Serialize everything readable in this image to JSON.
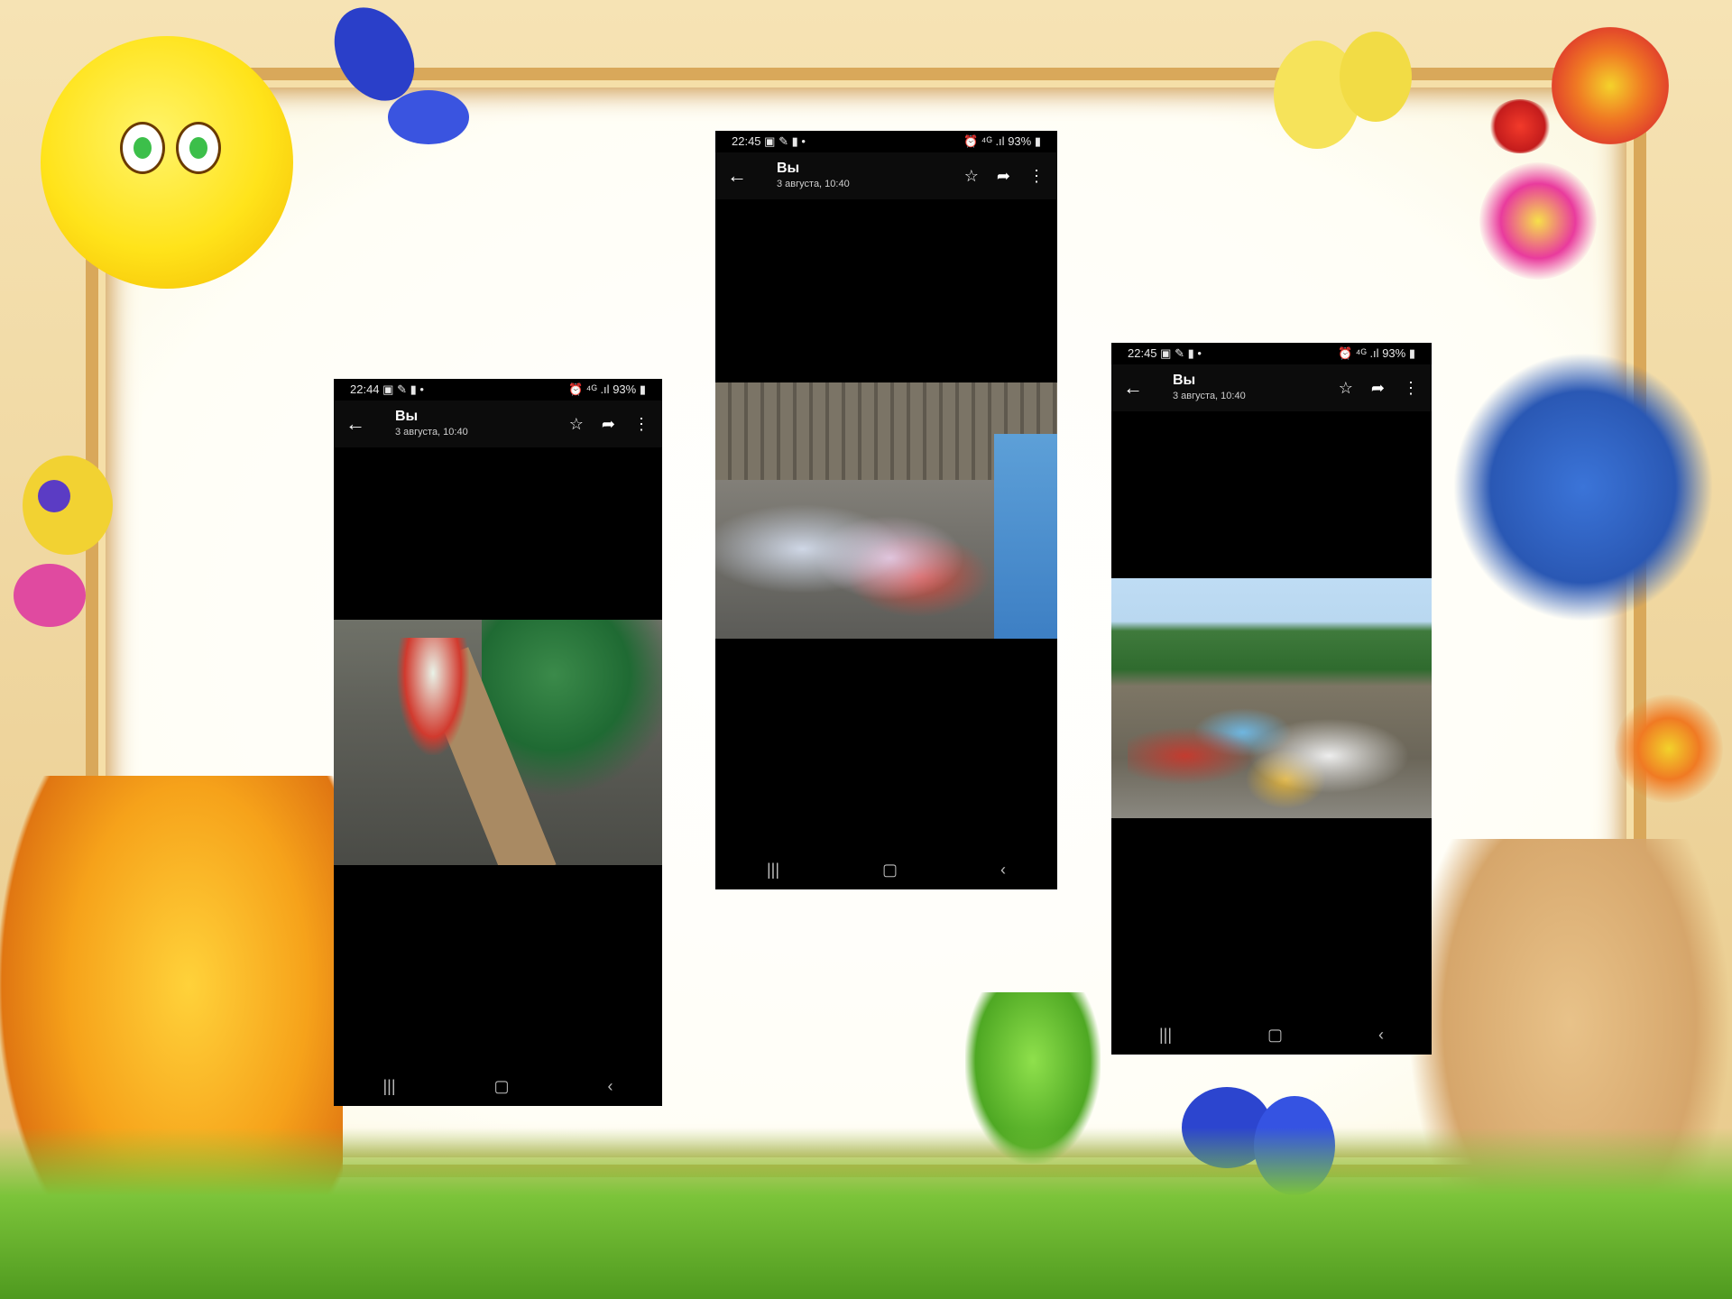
{
  "phones": [
    {
      "status": {
        "time": "22:44",
        "left_icons": "▣ ✎ ▮ •",
        "right_icons": "⏰ ⁴ᴳ .ıl",
        "battery": "93%"
      },
      "appbar": {
        "title": "Вы",
        "subtitle": "3 августа, 10:40"
      },
      "icons": {
        "back": "←",
        "star": "☆",
        "share": "➦",
        "more": "⋮"
      },
      "nav": {
        "recents": "|||",
        "home": "▢",
        "back": "‹"
      }
    },
    {
      "status": {
        "time": "22:45",
        "left_icons": "▣ ✎ ▮ •",
        "right_icons": "⏰ ⁴ᴳ .ıl",
        "battery": "93%"
      },
      "appbar": {
        "title": "Вы",
        "subtitle": "3 августа, 10:40"
      },
      "icons": {
        "back": "←",
        "star": "☆",
        "share": "➦",
        "more": "⋮"
      },
      "nav": {
        "recents": "|||",
        "home": "▢",
        "back": "‹"
      }
    },
    {
      "status": {
        "time": "22:45",
        "left_icons": "▣ ✎ ▮ •",
        "right_icons": "⏰ ⁴ᴳ .ıl",
        "battery": "93%"
      },
      "appbar": {
        "title": "Вы",
        "subtitle": "3 августа, 10:40"
      },
      "icons": {
        "back": "←",
        "star": "☆",
        "share": "➦",
        "more": "⋮"
      },
      "nav": {
        "recents": "|||",
        "home": "▢",
        "back": "‹"
      }
    }
  ],
  "colors": {
    "frame": "#d9a85a",
    "grass": "#5aa624",
    "phone_bg": "#000000"
  }
}
